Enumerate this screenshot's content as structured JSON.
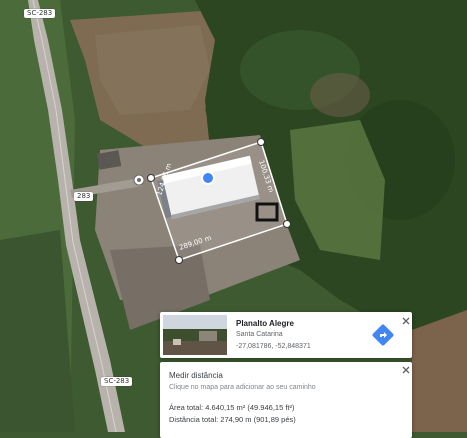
{
  "map": {
    "road_labels": [
      "SC-283",
      "283",
      "SC-283"
    ],
    "measurement": {
      "edge_labels": [
        "124,96 m",
        "100,33 m",
        "289,00 m"
      ]
    }
  },
  "place_card": {
    "title": "Planalto Alegre",
    "subtitle": "Santa Catarina",
    "coordinates": "-27,081786, -52,848371",
    "directions_icon": "directions-icon",
    "close_icon": "close-icon"
  },
  "measure_card": {
    "title": "Medir distância",
    "hint": "Clique no mapa para adicionar ao seu caminho",
    "total_area": "Área total: 4.640,15 m² (49.946,15 ft²)",
    "total_distance": "Distância total: 274,90 m (901,89 pés)",
    "close_icon": "close-icon"
  },
  "colors": {
    "accent_blue": "#4285f4",
    "forest": "#2f4a24",
    "field": "#7d6a4f"
  }
}
